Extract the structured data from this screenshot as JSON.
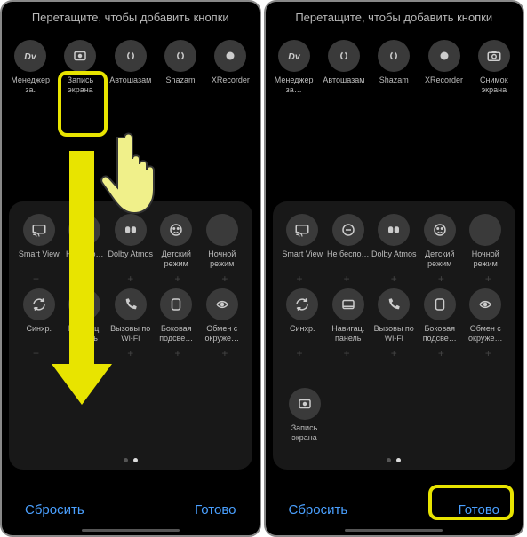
{
  "header": "Перетащите, чтобы добавить кнопки",
  "left": {
    "top": [
      {
        "name": "menedjer",
        "label": "Менеджер за.",
        "icon": "dev"
      },
      {
        "name": "zapis-ekrana",
        "label": "Запись экрана",
        "icon": "record-rect"
      },
      {
        "name": "avtoshazam",
        "label": "Автошазам",
        "icon": "shazam"
      },
      {
        "name": "shazam",
        "label": "Shazam",
        "icon": "shazam"
      },
      {
        "name": "xrecorder",
        "label": "XRecorder",
        "icon": "rec-dot"
      }
    ],
    "panel": [
      [
        {
          "name": "smartview",
          "label": "Smart View",
          "icon": "cast"
        },
        {
          "name": "ne-bespo",
          "label": "Н беспо…",
          "icon": "dnd"
        },
        {
          "name": "dolby",
          "label": "Dolby Atmos",
          "icon": "dolby"
        },
        {
          "name": "detskiy",
          "label": "Детский режим",
          "icon": "child"
        },
        {
          "name": "nochnoy",
          "label": "Ночной режим",
          "icon": "moon"
        }
      ],
      [
        {
          "name": "sinhr",
          "label": "Синхр.",
          "icon": "sync"
        },
        {
          "name": "navigac",
          "label": "Навигац. панель",
          "icon": "navbar"
        },
        {
          "name": "vyzovy-wifi",
          "label": "Вызовы по Wi-Fi",
          "icon": "wificall"
        },
        {
          "name": "bokovaya",
          "label": "Боковая подсве…",
          "icon": "edge"
        },
        {
          "name": "obmen",
          "label": "Обмен с окруже…",
          "icon": "share"
        }
      ]
    ]
  },
  "right": {
    "top": [
      {
        "name": "menedjer",
        "label": "Менеджер за…",
        "icon": "dev"
      },
      {
        "name": "avtoshazam",
        "label": "Автошазам",
        "icon": "shazam"
      },
      {
        "name": "shazam",
        "label": "Shazam",
        "icon": "shazam"
      },
      {
        "name": "xrecorder",
        "label": "XRecorder",
        "icon": "rec-dot"
      },
      {
        "name": "snimok",
        "label": "Снимок экрана",
        "icon": "camera"
      }
    ],
    "panel": [
      [
        {
          "name": "smartview",
          "label": "Smart View",
          "icon": "cast"
        },
        {
          "name": "ne-bespo",
          "label": "Не беспо…",
          "icon": "dnd"
        },
        {
          "name": "dolby",
          "label": "Dolby Atmos",
          "icon": "dolby"
        },
        {
          "name": "detskiy",
          "label": "Детский режим",
          "icon": "child"
        },
        {
          "name": "nochnoy",
          "label": "Ночной режим",
          "icon": "moon"
        }
      ],
      [
        {
          "name": "sinhr",
          "label": "Синхр.",
          "icon": "sync"
        },
        {
          "name": "navigac",
          "label": "Навигац. панель",
          "icon": "navbar"
        },
        {
          "name": "vyzovy-wifi",
          "label": "Вызовы по Wi-Fi",
          "icon": "wificall"
        },
        {
          "name": "bokovaya",
          "label": "Боковая подсве…",
          "icon": "edge"
        },
        {
          "name": "obmen",
          "label": "Обмен с окруже…",
          "icon": "share"
        }
      ]
    ],
    "orphan": {
      "name": "zapis-ekrana",
      "label": "Запись экрана",
      "icon": "record-rect"
    }
  },
  "footer": {
    "reset": "Сбросить",
    "done": "Готово"
  }
}
